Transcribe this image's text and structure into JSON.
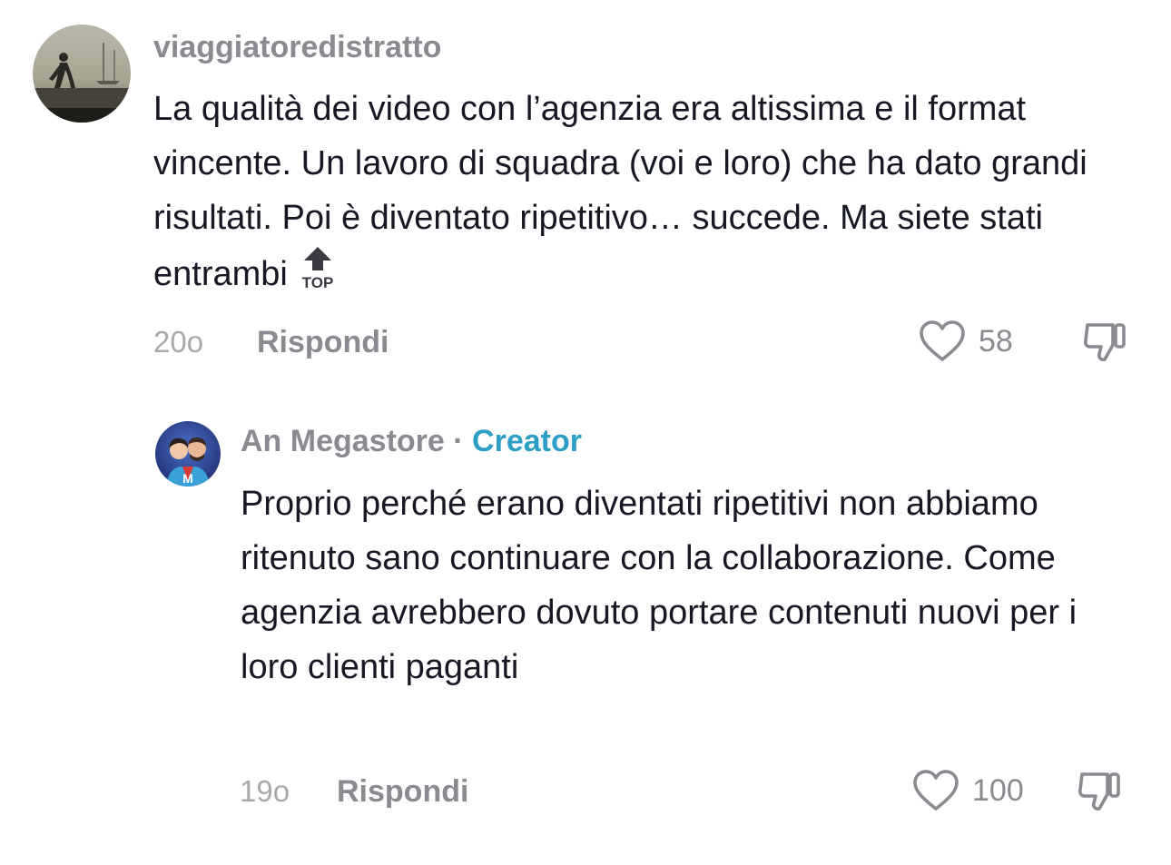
{
  "comments": [
    {
      "username": "viaggiatoredistratto",
      "text": "La qualità dei video con l’agenzia era altissima e il format vincente. Un lavoro di squadra (voi e loro) che ha dato grandi risultati. Poi è diventato ripetitivo… succede. Ma siete stati entrambi",
      "inline_icon": "top-arrow-icon",
      "inline_icon_label": "TOP",
      "time": "20o",
      "reply_label": "Rispondi",
      "likes": "58",
      "like_icon": "heart-outline-icon",
      "dislike_icon": "thumbs-down-icon"
    },
    {
      "username": "An Megastore",
      "separator": " · ",
      "badge": "Creator",
      "text": "Proprio perché erano diventati ripetitivi non abbiamo ritenuto sano continuare con la collaborazione. Come agenzia avrebbero dovuto portare contenuti nuovi per i loro clienti paganti",
      "time": "19o",
      "reply_label": "Rispondi",
      "likes": "100",
      "like_icon": "heart-outline-icon",
      "dislike_icon": "thumbs-down-icon"
    }
  ],
  "colors": {
    "text": "#161823",
    "secondary": "#8a8b91",
    "timestamp": "#a8a9ad",
    "creator": "#2d9fc6"
  }
}
